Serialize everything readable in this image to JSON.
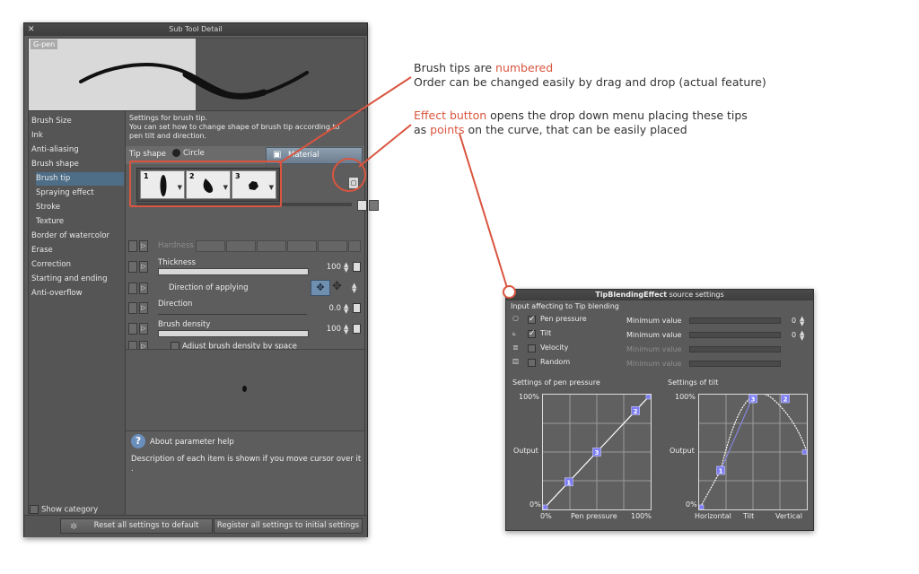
{
  "window": {
    "title": "Sub Tool Detail",
    "preview_label": "G-pen"
  },
  "categories": [
    {
      "label": "Brush Size",
      "sub": false,
      "selected": false
    },
    {
      "label": "Ink",
      "sub": false,
      "selected": false
    },
    {
      "label": "Anti-aliasing",
      "sub": false,
      "selected": false
    },
    {
      "label": "Brush shape",
      "sub": false,
      "selected": false
    },
    {
      "label": "Brush tip",
      "sub": true,
      "selected": true
    },
    {
      "label": "Spraying effect",
      "sub": true,
      "selected": false
    },
    {
      "label": "Stroke",
      "sub": true,
      "selected": false
    },
    {
      "label": "Texture",
      "sub": true,
      "selected": false
    },
    {
      "label": "Border of watercolor",
      "sub": false,
      "selected": false
    },
    {
      "label": "Erase",
      "sub": false,
      "selected": false
    },
    {
      "label": "Correction",
      "sub": false,
      "selected": false
    },
    {
      "label": "Starting and ending",
      "sub": false,
      "selected": false
    },
    {
      "label": "Anti-overflow",
      "sub": false,
      "selected": false
    }
  ],
  "show_category": "Show category",
  "panel": {
    "desc_line1": "Settings for brush tip.",
    "desc_line2": "You can set how to change shape of brush tip according to",
    "desc_line3": "pen tilt and direction.",
    "tip_shape_label": "Tip shape",
    "circle_label": "Circle",
    "material_label": "Material",
    "tips": [
      "1",
      "2",
      "3"
    ],
    "hardness": "Hardness",
    "thickness": "Thickness",
    "thickness_value": "100",
    "direction_of_applying": "Direction of applying",
    "direction": "Direction",
    "direction_value": "0.0",
    "brush_density": "Brush density",
    "brush_density_value": "100",
    "adjust_density": "Adjust brush density by space",
    "help_title": "About parameter help",
    "help_desc": "Description of each item is shown if you move cursor over it",
    "help_dot": "."
  },
  "buttons": {
    "reset": "Reset all settings to default",
    "register": "Register all settings to initial settings"
  },
  "annotations": {
    "a1_prefix": "Brush tips are ",
    "a1_red": "numbered",
    "a1_line2": "Order can be changed easily by drag and drop (actual feature)",
    "a2_red1": "Effect button",
    "a2_mid": " opens the drop down menu placing these tips",
    "a2_as": "as ",
    "a2_red2": "points",
    "a2_rest": " on the curve, that can be easily placed"
  },
  "effect": {
    "title_bold": "TipBlendingEffect",
    "title_rest": " source settings",
    "input_label": "Input affecting to Tip blending",
    "inputs": [
      {
        "label": "Pen pressure",
        "checked": true,
        "min_label": "Minimum value",
        "value": "0",
        "enabled": true
      },
      {
        "label": "Tilt",
        "checked": true,
        "min_label": "Minimum value",
        "value": "0",
        "enabled": true
      },
      {
        "label": "Velocity",
        "checked": false,
        "min_label": "Minimum value",
        "value": "",
        "enabled": false
      },
      {
        "label": "Random",
        "checked": false,
        "min_label": "Minimum value",
        "value": "",
        "enabled": false
      }
    ],
    "pressure_graph": {
      "title": "Settings of pen pressure",
      "y_top": "100%",
      "y_mid": "Output",
      "y_bot": "0%",
      "x_left": "0%",
      "x_mid": "Pen pressure",
      "x_right": "100%",
      "points": [
        {
          "x": 0,
          "y": 0,
          "label": ""
        },
        {
          "x": 0.24,
          "y": 0.24,
          "label": "1"
        },
        {
          "x": 0.5,
          "y": 0.5,
          "label": "3"
        },
        {
          "x": 0.86,
          "y": 0.86,
          "label": "2"
        },
        {
          "x": 1,
          "y": 1,
          "label": ""
        }
      ]
    },
    "tilt_graph": {
      "title": "Settings of tilt",
      "y_top": "100%",
      "y_mid": "Output",
      "y_bot": "0%",
      "x_left": "Horizontal",
      "x_mid": "Tilt",
      "x_right": "Vertical",
      "points": [
        {
          "x": 0,
          "y": 0,
          "label": ""
        },
        {
          "x": 0.2,
          "y": 0.34,
          "label": "1"
        },
        {
          "x": 0.5,
          "y": 1.0,
          "label": "3"
        },
        {
          "x": 0.8,
          "y": 1.0,
          "label": "2"
        },
        {
          "x": 1,
          "y": 0.5,
          "label": ""
        }
      ]
    }
  }
}
